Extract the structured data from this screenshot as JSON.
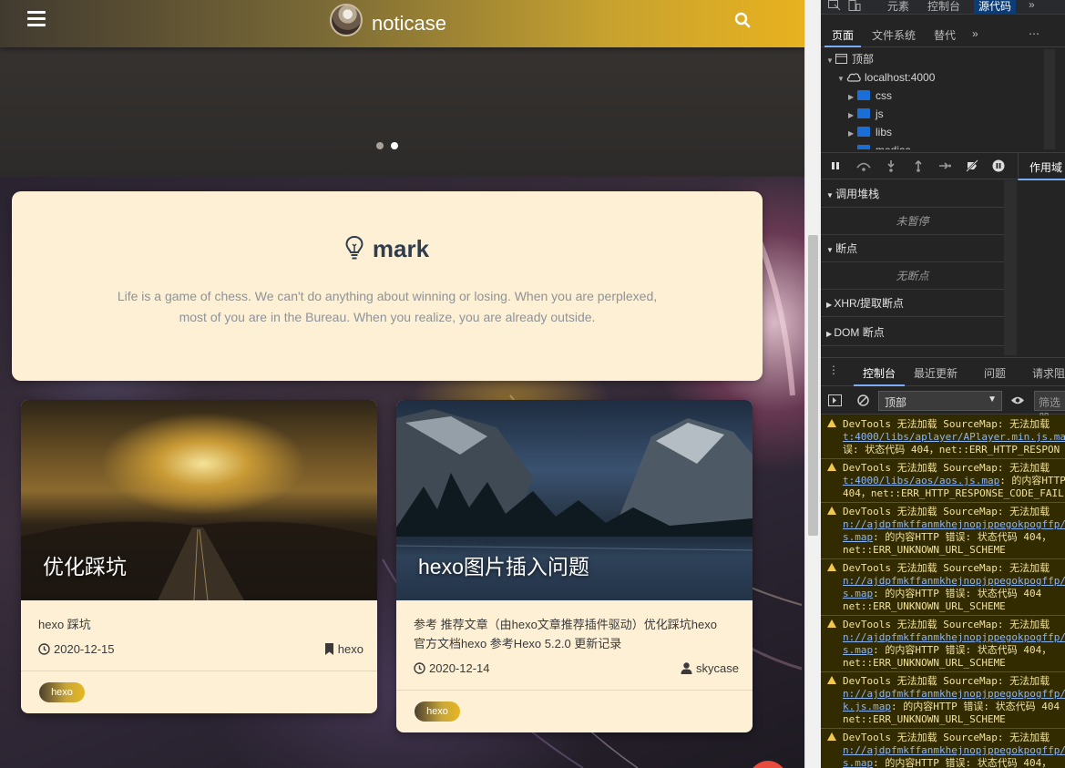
{
  "site": {
    "title": "noticase",
    "banner_dots": 2
  },
  "mark": {
    "title": "mark",
    "description": "Life is a game of chess. We can't do anything about winning or losing. When you are perplexed, most of you are in the Bureau. When you realize, you are already outside."
  },
  "posts": [
    {
      "title": "优化踩坑",
      "excerpt": "hexo 踩坑",
      "date": "2020-12-15",
      "meta_right": "hexo",
      "meta_right_icon": "bookmark-icon",
      "tag": "hexo"
    },
    {
      "title": "hexo图片插入问题",
      "excerpt_line1": "参考 推荐文章（由hexo文章推荐插件驱动）优化踩坑hexo",
      "excerpt_line2": "官方文档hexo 参考Hexo 5.2.0 更新记录",
      "date": "2020-12-14",
      "meta_right": "skycase",
      "meta_right_icon": "user-icon",
      "tag": "hexo"
    }
  ],
  "devtools": {
    "top_tabs": [
      "元素",
      "控制台",
      "源代码"
    ],
    "active_top_tab": "源代码",
    "sub_tabs": [
      "页面",
      "文件系统",
      "替代"
    ],
    "tree": {
      "root": "顶部",
      "host": "localhost:4000",
      "folders": [
        "css",
        "js",
        "libs",
        "medias"
      ]
    },
    "scope_tab": "作用域",
    "sections": {
      "call_stack": "调用堆栈",
      "not_paused": "未暂停",
      "breakpoints": "断点",
      "no_breakpoints": "无断点",
      "xhr": "XHR/提取断点",
      "dom": "DOM 断点"
    },
    "console_tabs": [
      "控制台",
      "最近更新",
      "问题",
      "请求阻"
    ],
    "context": "顶部",
    "filter_placeholder": "筛选器",
    "logs": [
      {
        "l1": "DevTools 无法加载 SourceMap:  无法加载",
        "l2": "t:4000/libs/aplayer/APlayer.min.js.ma",
        "l3": "误: 状态代码 404，net::ERR_HTTP_RESPON"
      },
      {
        "l1": "DevTools 无法加载 SourceMap:  无法加载",
        "l2": "t:4000/libs/aos/aos.js.map",
        "l2b": ": 的内容HTTP",
        "l3": "404，net::ERR_HTTP_RESPONSE_CODE_FAIL"
      },
      {
        "l1": "DevTools 无法加载 SourceMap:  无法加载",
        "l2": "n://ajdpfmkffanmkhejnopjppegokpogffp/",
        "l3a": "s.map",
        "l3b": ": 的内容HTTP 错误: 状态代码 404，",
        "l4": "net::ERR_UNKNOWN_URL_SCHEME"
      },
      {
        "l1": "DevTools 无法加载 SourceMap:  无法加载",
        "l2": "n://ajdpfmkffanmkhejnopjppegokpogffp/",
        "l3a": "s.map",
        "l3b": ": 的内容HTTP 错误: 状态代码 404",
        "l4": "net::ERR_UNKNOWN_URL_SCHEME"
      },
      {
        "l1": "DevTools 无法加载 SourceMap:  无法加载",
        "l2": "n://ajdpfmkffanmkhejnopjppegokpogffp/",
        "l3a": "s.map",
        "l3b": ": 的内容HTTP 错误: 状态代码 404，",
        "l4": "net::ERR_UNKNOWN_URL_SCHEME"
      },
      {
        "l1": "DevTools 无法加载 SourceMap:  无法加载",
        "l2": "n://ajdpfmkffanmkhejnopjppegokpogffp/",
        "l3a": "k.js.map",
        "l3b": ": 的内容HTTP 错误: 状态代码 404",
        "l4": "net::ERR_UNKNOWN_URL_SCHEME"
      },
      {
        "l1": "DevTools 无法加载 SourceMap:  无法加载",
        "l2": "n://ajdpfmkffanmkhejnopjppegokpogffp/",
        "l3a": "s.map",
        "l3b": ": 的内容HTTP 错误: 状态代码 404，",
        "l4": ""
      }
    ]
  },
  "colors": {
    "accent": "#e8b21f",
    "card_bg": "#fdf0d5",
    "devtools_bg": "#242424",
    "warning_bg": "#332b00"
  }
}
